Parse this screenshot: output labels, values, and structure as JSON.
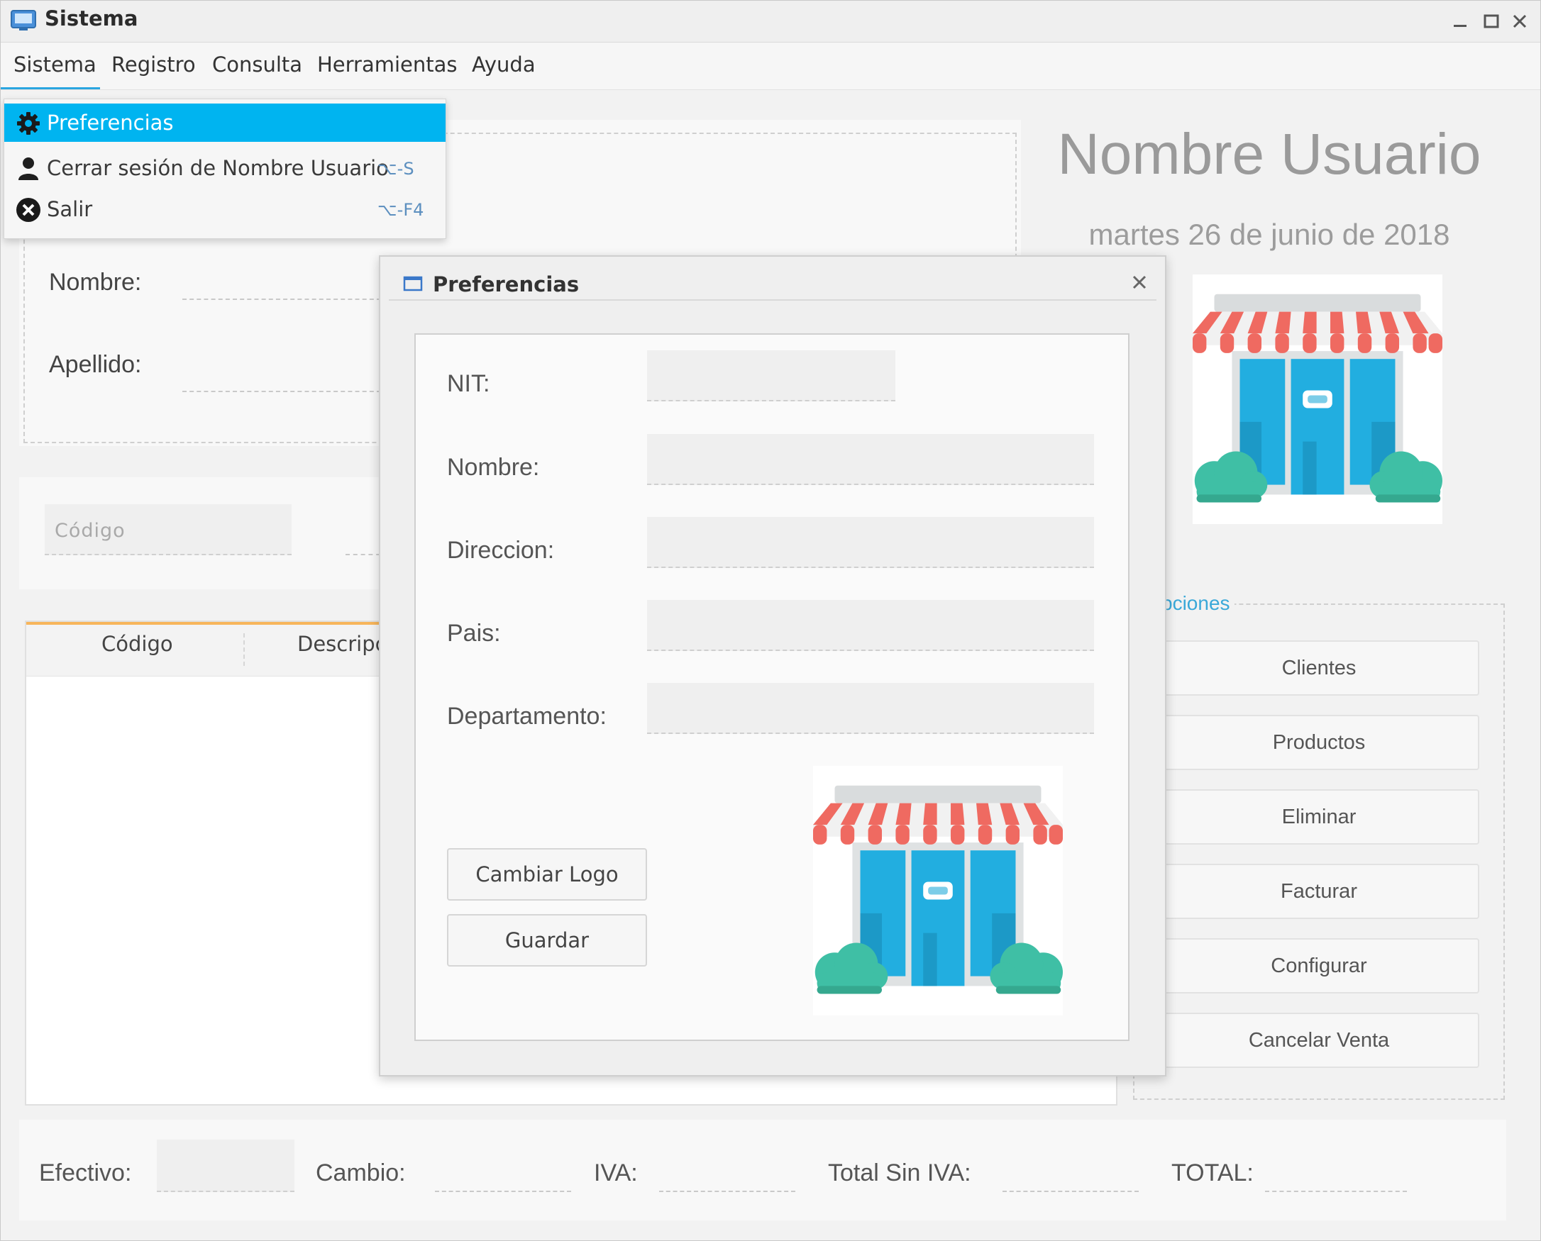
{
  "window": {
    "title": "Sistema"
  },
  "menubar": {
    "items": [
      "Sistema",
      "Registro",
      "Consulta",
      "Herramientas",
      "Ayuda"
    ]
  },
  "dropdown": {
    "items": [
      {
        "label": "Preferencias",
        "shortcut": "",
        "icon": "gear-icon"
      },
      {
        "label": "Cerrar sesión de Nombre Usuario",
        "shortcut": "⌥-S",
        "icon": "user-icon"
      },
      {
        "label": "Salir",
        "shortcut": "⌥-F4",
        "icon": "close-circle-icon"
      }
    ]
  },
  "client_panel": {
    "nombre_label": "Nombre:",
    "apellido_label": "Apellido:"
  },
  "product_panel": {
    "codigo_placeholder": "Código"
  },
  "table": {
    "headers": [
      "Código",
      "Descripc"
    ]
  },
  "user_panel": {
    "name": "Nombre Usuario",
    "date": "martes 26 de junio de 2018"
  },
  "options_panel": {
    "title": "pciones",
    "buttons": [
      "Clientes",
      "Productos",
      "Eliminar",
      "Facturar",
      "Configurar",
      "Cancelar Venta"
    ]
  },
  "footer": {
    "efectivo": "Efectivo:",
    "cambio": "Cambio:",
    "iva": "IVA:",
    "total_sin_iva": "Total Sin IVA:",
    "total": "TOTAL:"
  },
  "preferences_dialog": {
    "title": "Preferencias",
    "fields": [
      {
        "label": "NIT:",
        "value": ""
      },
      {
        "label": "Nombre:",
        "value": ""
      },
      {
        "label": "Direccion:",
        "value": ""
      },
      {
        "label": "Pais:",
        "value": ""
      },
      {
        "label": "Departamento:",
        "value": ""
      }
    ],
    "change_logo_label": "Cambiar Logo",
    "save_label": "Guardar"
  },
  "colors": {
    "accent": "#00b4f0",
    "awning_red": "#ef6a61",
    "shop_blue": "#22aee0",
    "bush_green": "#3fbfa5"
  }
}
